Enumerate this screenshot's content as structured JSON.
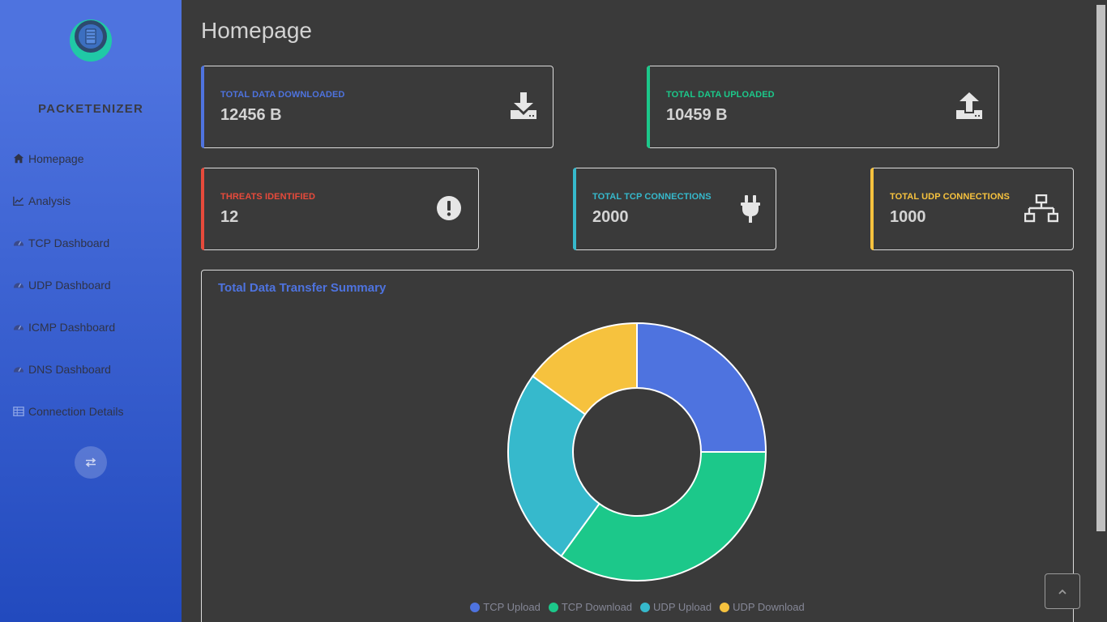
{
  "sidebar": {
    "brand": "PACKETENIZER",
    "items": [
      {
        "label": "Homepage",
        "icon": "home-icon"
      },
      {
        "label": "Analysis",
        "icon": "chart-line-icon"
      },
      {
        "label": "TCP Dashboard",
        "icon": "gauge-icon"
      },
      {
        "label": "UDP Dashboard",
        "icon": "gauge-icon"
      },
      {
        "label": "ICMP Dashboard",
        "icon": "gauge-icon"
      },
      {
        "label": "DNS Dashboard",
        "icon": "gauge-icon"
      },
      {
        "label": "Connection Details",
        "icon": "table-icon"
      }
    ],
    "toggle_icon": "swap-arrows-icon"
  },
  "page": {
    "title": "Homepage"
  },
  "cards": {
    "downloaded": {
      "label": "TOTAL DATA DOWNLOADED",
      "value": "12456 B",
      "color": "#4e73df",
      "icon": "download-icon"
    },
    "uploaded": {
      "label": "TOTAL DATA UPLOADED",
      "value": "10459 B",
      "color": "#1cc88a",
      "icon": "upload-icon"
    },
    "threats": {
      "label": "THREATS IDENTIFIED",
      "value": "12",
      "color": "#e74a3b",
      "icon": "exclamation-circle-icon"
    },
    "tcp": {
      "label": "TOTAL TCP CONNECTIONS",
      "value": "2000",
      "color": "#36b9cc",
      "icon": "plug-icon"
    },
    "udp": {
      "label": "TOTAL UDP CONNECTIONS",
      "value": "1000",
      "color": "#f6c23e",
      "icon": "network-icon"
    }
  },
  "chart_card": {
    "title": "Total Data Transfer Summary"
  },
  "chart_data": {
    "type": "pie",
    "title": "Total Data Transfer Summary",
    "categories": [
      "TCP Upload",
      "TCP Download",
      "UDP Upload",
      "UDP Download"
    ],
    "values": [
      25,
      35,
      25,
      15
    ],
    "colors": [
      "#4e73df",
      "#1cc88a",
      "#36b9cc",
      "#f6c23e"
    ],
    "legend": "bottom",
    "donut": true
  },
  "scroll_top_icon": "chevron-up-icon"
}
